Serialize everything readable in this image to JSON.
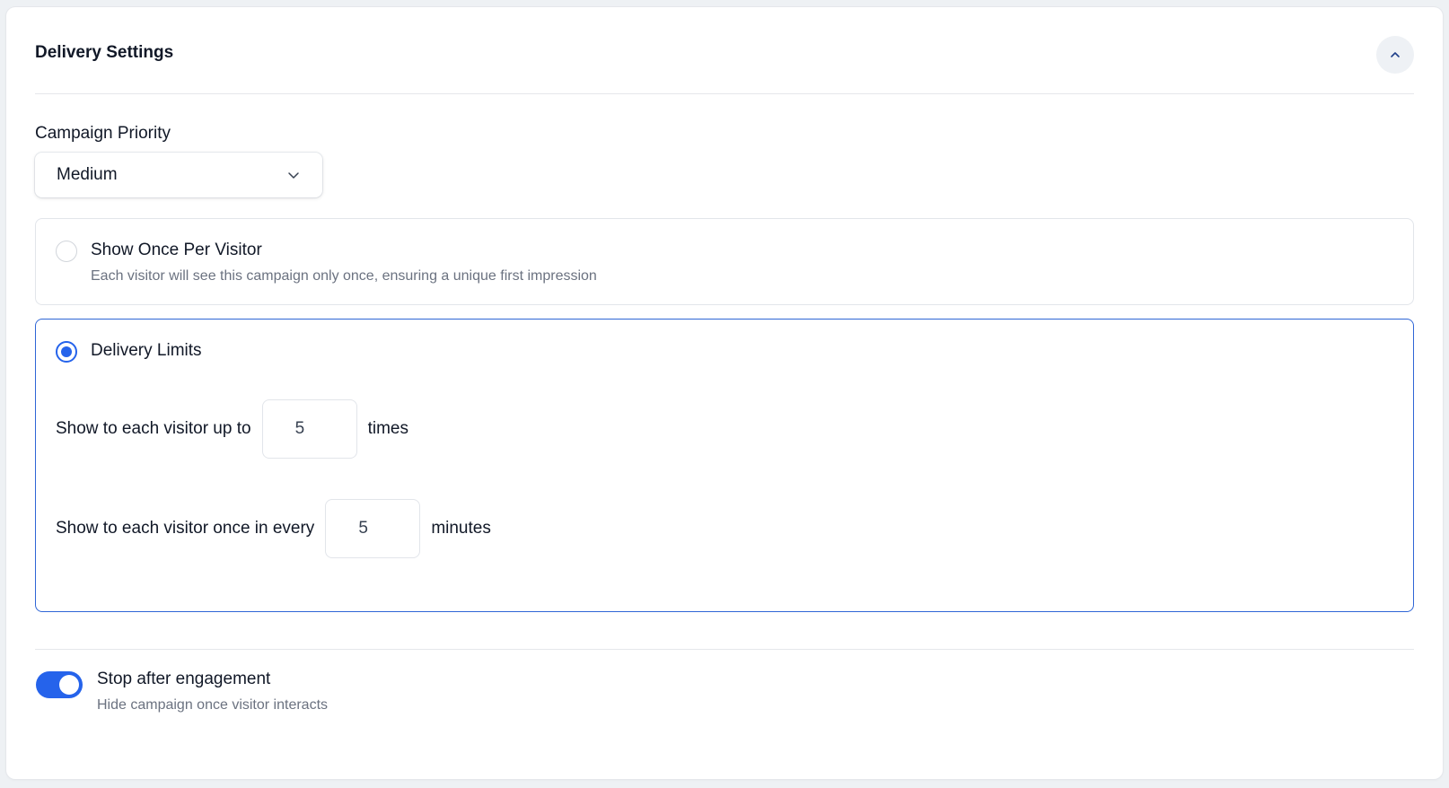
{
  "section": {
    "title": "Delivery Settings",
    "collapse_icon": "chevron-up-icon"
  },
  "priority": {
    "label": "Campaign Priority",
    "selected": "Medium",
    "dropdown_icon": "chevron-down-icon"
  },
  "options": {
    "once": {
      "title": "Show Once Per Visitor",
      "description": "Each visitor will see this campaign only once, ensuring a unique first impression",
      "selected": false
    },
    "limits": {
      "title": "Delivery Limits",
      "selected": true,
      "times_prefix": "Show to each visitor up to",
      "times_value": "5",
      "times_suffix": "times",
      "interval_prefix": "Show to each visitor once in every",
      "interval_value": "5",
      "interval_suffix": "minutes"
    }
  },
  "engagement": {
    "title": "Stop after engagement",
    "description": "Hide campaign once visitor interacts",
    "enabled": true
  },
  "colors": {
    "accent": "#2563eb",
    "selected_border": "#2f66d6",
    "muted_text": "#6b7280"
  }
}
